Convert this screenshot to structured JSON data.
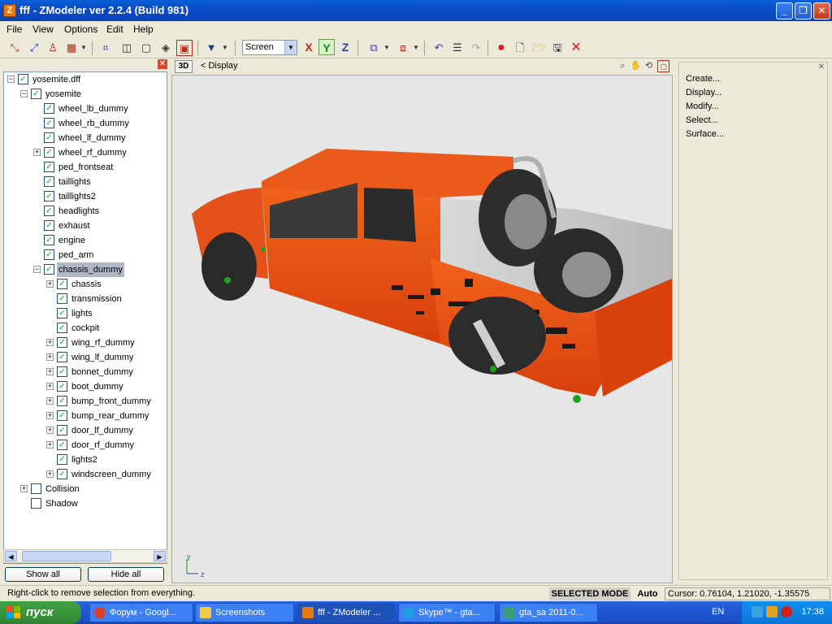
{
  "window": {
    "title": "fff - ZModeler ver 2.2.4 (Build 981)",
    "app_icon": "Z"
  },
  "menu": [
    "File",
    "View",
    "Options",
    "Edit",
    "Help"
  ],
  "toolbar": {
    "coord_space": "Screen",
    "axes": [
      {
        "label": "X",
        "color": "#c0281e"
      },
      {
        "label": "Y",
        "color": "#1f8a1f"
      },
      {
        "label": "Z",
        "color": "#2a3fb0"
      }
    ]
  },
  "tree": {
    "root": "yosemite.dff",
    "nodes": [
      {
        "label": "yosemite.dff",
        "depth": 0,
        "expander": "minus",
        "checked": true
      },
      {
        "label": "yosemite",
        "depth": 1,
        "expander": "minus",
        "checked": true
      },
      {
        "label": "wheel_lb_dummy",
        "depth": 2,
        "expander": "",
        "checked": true
      },
      {
        "label": "wheel_rb_dummy",
        "depth": 2,
        "expander": "",
        "checked": true
      },
      {
        "label": "wheel_lf_dummy",
        "depth": 2,
        "expander": "",
        "checked": true
      },
      {
        "label": "wheel_rf_dummy",
        "depth": 2,
        "expander": "plus",
        "checked": true
      },
      {
        "label": "ped_frontseat",
        "depth": 2,
        "expander": "",
        "checked": true
      },
      {
        "label": "taillights",
        "depth": 2,
        "expander": "",
        "checked": true
      },
      {
        "label": "taillights2",
        "depth": 2,
        "expander": "",
        "checked": true
      },
      {
        "label": "headlights",
        "depth": 2,
        "expander": "",
        "checked": true
      },
      {
        "label": "exhaust",
        "depth": 2,
        "expander": "",
        "checked": true
      },
      {
        "label": "engine",
        "depth": 2,
        "expander": "",
        "checked": true
      },
      {
        "label": "ped_arm",
        "depth": 2,
        "expander": "",
        "checked": true
      },
      {
        "label": "chassis_dummy",
        "depth": 2,
        "expander": "minus",
        "checked": true,
        "selected": true
      },
      {
        "label": "chassis",
        "depth": 3,
        "expander": "plus",
        "checked": true
      },
      {
        "label": "transmission",
        "depth": 3,
        "expander": "",
        "checked": true
      },
      {
        "label": "lights",
        "depth": 3,
        "expander": "",
        "checked": true
      },
      {
        "label": "cockpit",
        "depth": 3,
        "expander": "",
        "checked": true
      },
      {
        "label": "wing_rf_dummy",
        "depth": 3,
        "expander": "plus",
        "checked": true
      },
      {
        "label": "wing_lf_dummy",
        "depth": 3,
        "expander": "plus",
        "checked": true
      },
      {
        "label": "bonnet_dummy",
        "depth": 3,
        "expander": "plus",
        "checked": true
      },
      {
        "label": "boot_dummy",
        "depth": 3,
        "expander": "plus",
        "checked": true
      },
      {
        "label": "bump_front_dummy",
        "depth": 3,
        "expander": "plus",
        "checked": true
      },
      {
        "label": "bump_rear_dummy",
        "depth": 3,
        "expander": "plus",
        "checked": true
      },
      {
        "label": "door_lf_dummy",
        "depth": 3,
        "expander": "plus",
        "checked": true
      },
      {
        "label": "door_rf_dummy",
        "depth": 3,
        "expander": "plus",
        "checked": true
      },
      {
        "label": "lights2",
        "depth": 3,
        "expander": "",
        "checked": true
      },
      {
        "label": "windscreen_dummy",
        "depth": 3,
        "expander": "plus",
        "checked": true
      },
      {
        "label": "Collision",
        "depth": 1,
        "expander": "plus",
        "checked": false
      },
      {
        "label": "Shadow",
        "depth": 1,
        "expander": "",
        "checked": false
      }
    ],
    "show_all": "Show all",
    "hide_all": "Hide all"
  },
  "viewport": {
    "mode_button": "3D",
    "breadcrumb": "<  Display",
    "axis_labels": {
      "y": "y",
      "z": "z"
    }
  },
  "commands": [
    "Create...",
    "Display...",
    "Modify...",
    "Select...",
    "Surface..."
  ],
  "status": {
    "message": "Right-click to remove selection from everything.",
    "mode": "SELECTED MODE",
    "auto": "Auto",
    "cursor": "Cursor: 0.76104, 1.21020, -1.35575"
  },
  "taskbar": {
    "start": "пуск",
    "tasks": [
      {
        "label": "Форум - Googl...",
        "icon_color": "#d8402c"
      },
      {
        "label": "Screenshots",
        "icon_color": "#f2c94c"
      },
      {
        "label": "fff - ZModeler ...",
        "icon_color": "#e87a12",
        "active": true
      },
      {
        "label": "Skype™ - gta...",
        "icon_color": "#1ea0e0"
      },
      {
        "label": "gta_sa 2011-0...",
        "icon_color": "#3aa070"
      }
    ],
    "language": "EN",
    "clock": "17:38"
  }
}
